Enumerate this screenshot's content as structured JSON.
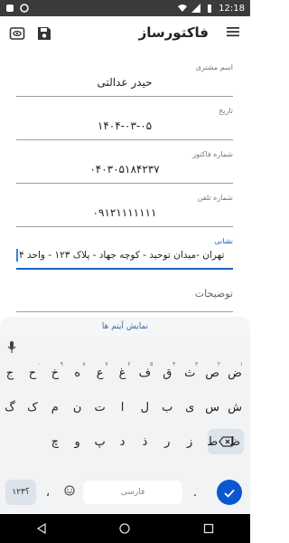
{
  "status_bar": {
    "time": "12:18"
  },
  "app": {
    "title": "فاکتورساز"
  },
  "form": {
    "customer": {
      "label": "اسم مشتری",
      "value": "حیدر عدالتی"
    },
    "date": {
      "label": "تاریخ",
      "value": "۱۴۰۴-۰۳-۰۵"
    },
    "invoice": {
      "label": "شماره فاکتور",
      "value": "۰۴۰۳۰۵۱۸۴۲۳۷"
    },
    "phone": {
      "label": "شماره تلفن",
      "value": "۰۹۱۲۱۱۱۱۱۱۱"
    },
    "address": {
      "label": "نشانی",
      "value": "تهران -میدان توحید - کوچه جهاد - پلاک ۱۲۳ - واحد ۴"
    },
    "description": {
      "placeholder": "توضیحات"
    }
  },
  "show_items": {
    "label": "نمایش آیتم ها"
  },
  "keyboard": {
    "row1": [
      {
        "k": "ض",
        "n": "۱"
      },
      {
        "k": "ص",
        "n": "۲"
      },
      {
        "k": "ث",
        "n": "۳"
      },
      {
        "k": "ق",
        "n": "۴"
      },
      {
        "k": "ف",
        "n": "۵"
      },
      {
        "k": "غ",
        "n": "۶"
      },
      {
        "k": "ع",
        "n": "۷"
      },
      {
        "k": "ه",
        "n": "۸"
      },
      {
        "k": "خ",
        "n": "۹"
      },
      {
        "k": "ح",
        "n": "۰"
      },
      {
        "k": "ج",
        "n": ""
      }
    ],
    "row2": [
      "ش",
      "س",
      "ی",
      "ب",
      "ل",
      "ا",
      "ت",
      "ن",
      "م",
      "ک",
      "گ"
    ],
    "row3": [
      "ظ",
      "ط",
      "ز",
      "ر",
      "ذ",
      "د",
      "پ",
      "و",
      "چ"
    ],
    "symbols_label": "؟۱۲۳",
    "comma": "،",
    "space_label": "فارسی",
    "period": "."
  }
}
